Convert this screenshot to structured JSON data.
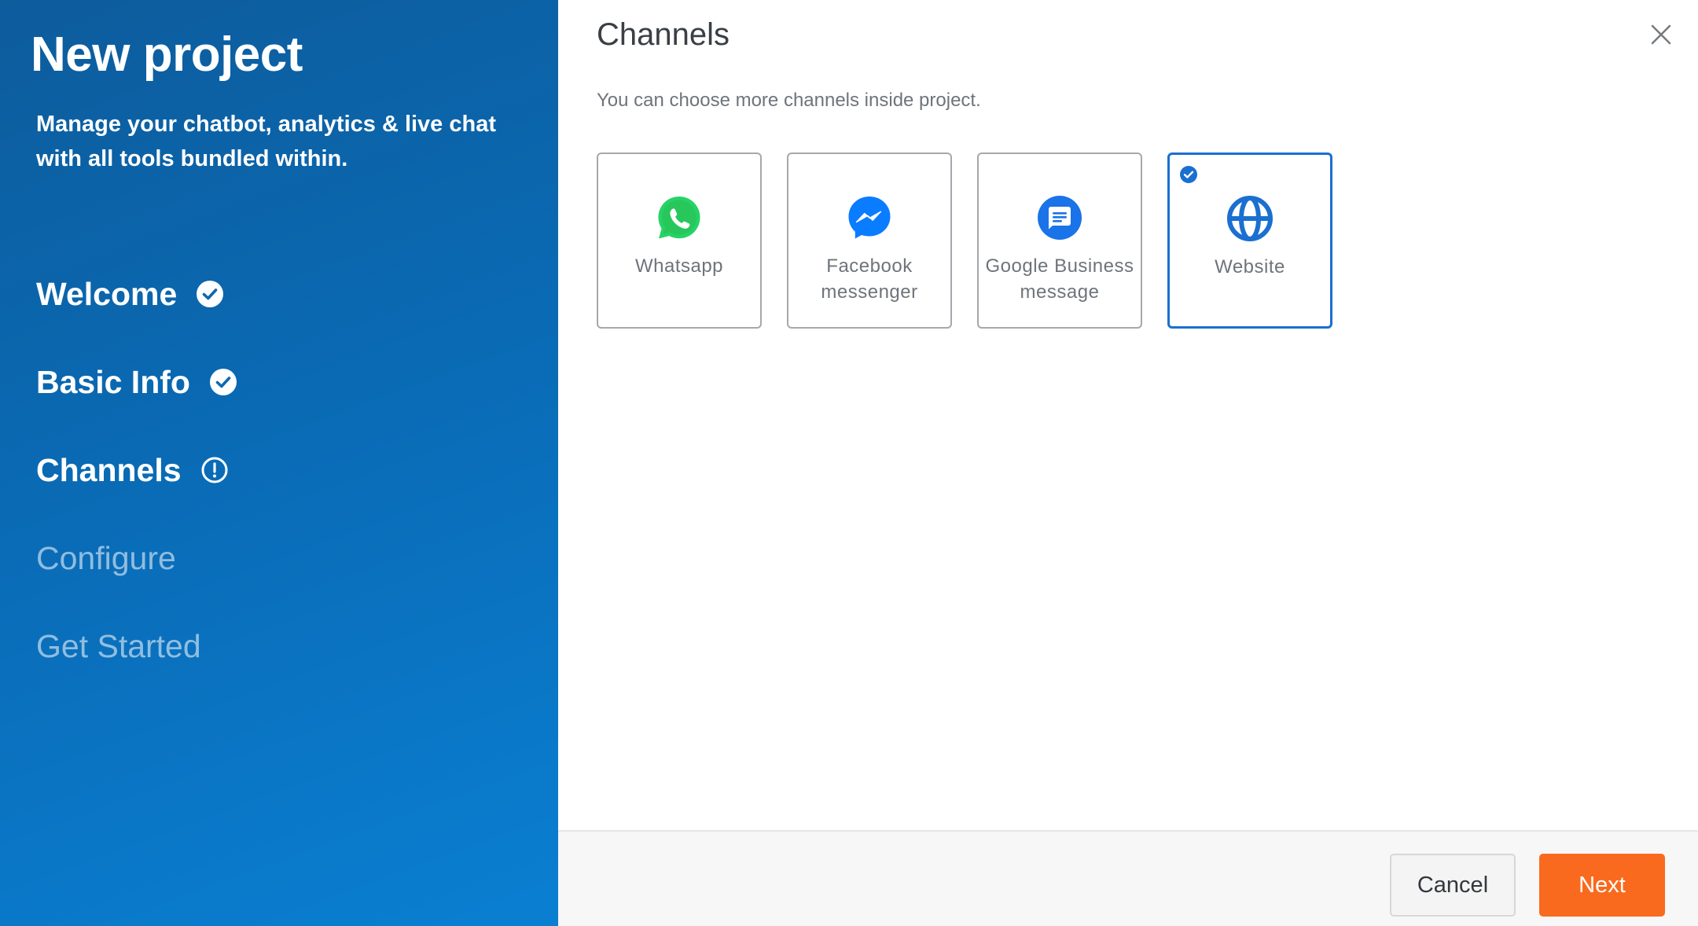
{
  "sidebar": {
    "title": "New project",
    "subtitle": "Manage your chatbot, analytics & live chat with all tools bundled within.",
    "steps": [
      {
        "label": "Welcome",
        "status": "complete",
        "icon": "check-circle-icon"
      },
      {
        "label": "Basic Info",
        "status": "complete",
        "icon": "check-circle-icon"
      },
      {
        "label": "Channels",
        "status": "current",
        "icon": "alert-circle-icon"
      },
      {
        "label": "Configure",
        "status": "upcoming"
      },
      {
        "label": "Get Started",
        "status": "upcoming"
      }
    ]
  },
  "main": {
    "title": "Channels",
    "subtitle": "You can choose more channels inside project.",
    "close_icon": "close-icon",
    "channels": [
      {
        "label": "Whatsapp",
        "icon": "whatsapp-icon",
        "selected": false
      },
      {
        "label": "Facebook messenger",
        "icon": "messenger-icon",
        "selected": false
      },
      {
        "label": "Google Business message",
        "icon": "google-business-message-icon",
        "selected": false
      },
      {
        "label": "Website",
        "icon": "globe-icon",
        "selected": true
      }
    ]
  },
  "footer": {
    "cancel_label": "Cancel",
    "next_label": "Next"
  },
  "colors": {
    "sidebar_gradient_start": "#0d5c9c",
    "sidebar_gradient_end": "#0a7fd2",
    "selected_border": "#1a6fd1",
    "next_button": "#fa6a1e",
    "whatsapp_green": "#25d366",
    "messenger_blue": "#0a7cff",
    "google_blue": "#1a73e8",
    "globe_blue": "#1a6fd1"
  }
}
